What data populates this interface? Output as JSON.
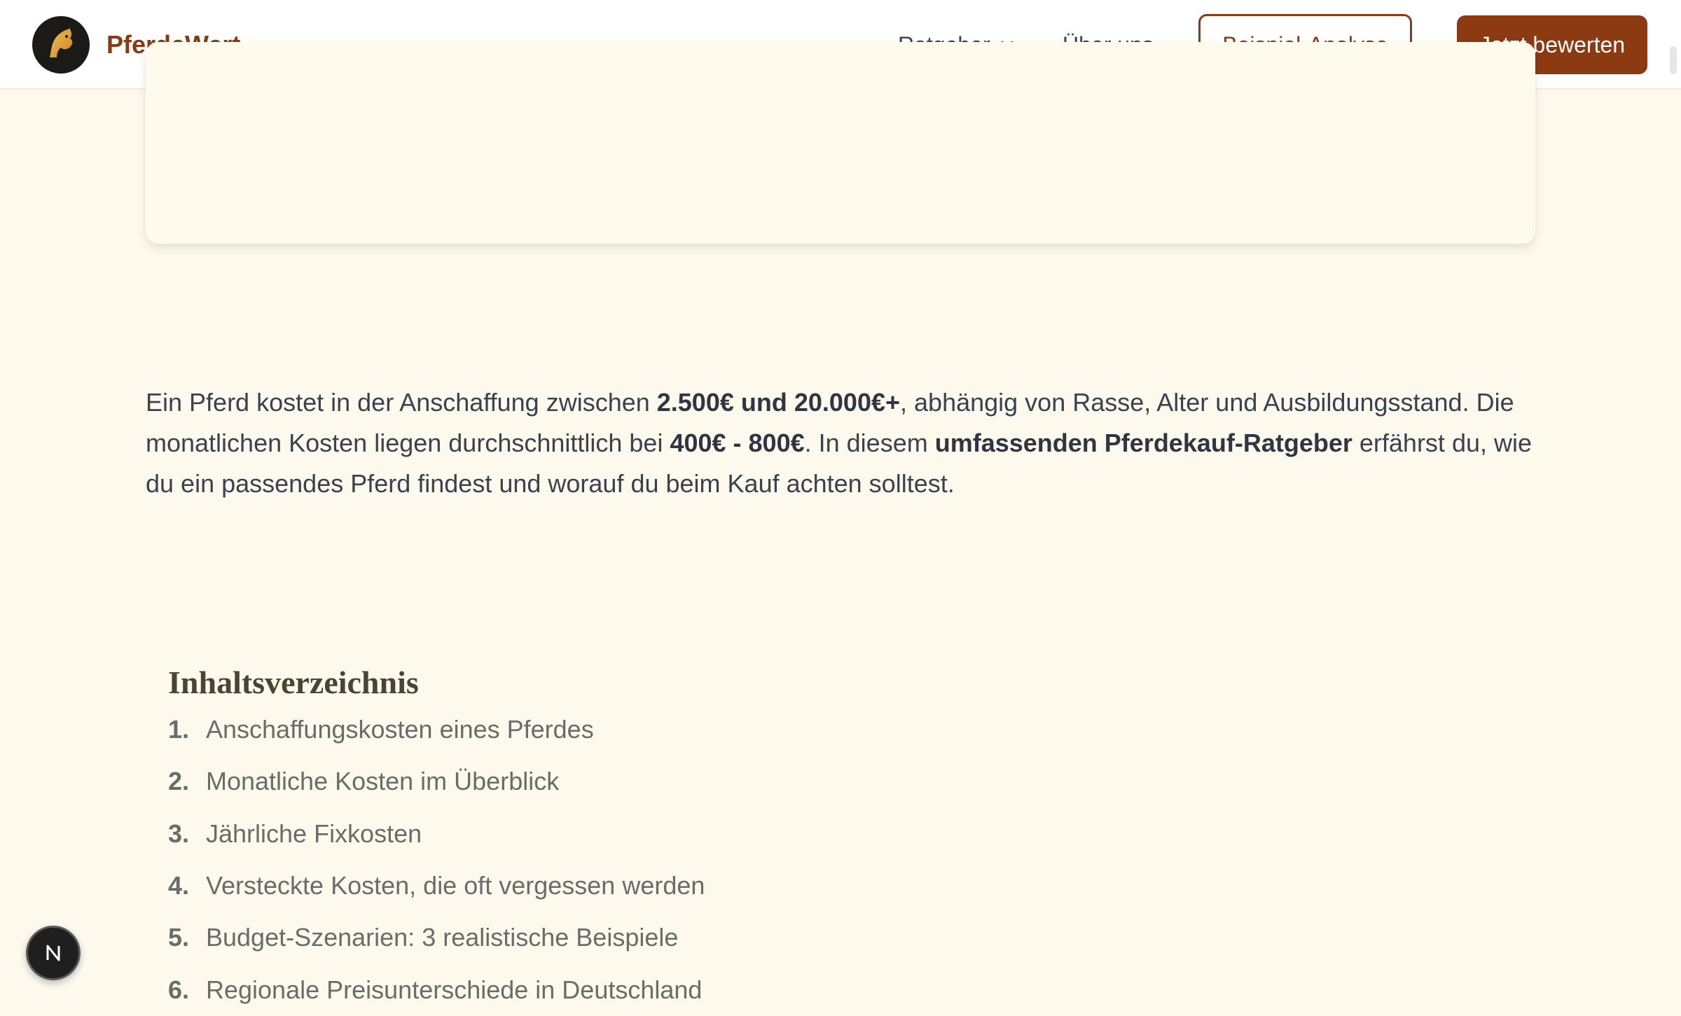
{
  "header": {
    "brand": "PferdeWert",
    "nav": {
      "ratgeber": "Ratgeber",
      "about": "Über uns"
    },
    "buttons": {
      "example": "Beispiel-Analyse",
      "cta": "Jetzt bewerten"
    }
  },
  "intro": {
    "p1": "Ein Pferd kostet in der Anschaffung zwischen ",
    "b1": "2.500€ und 20.000€+",
    "p2": ", abhängig von Rasse, Alter und Ausbildungsstand. Die monatlichen Kosten liegen durchschnittlich bei ",
    "b2": "400€ - 800€",
    "p3": ". In diesem ",
    "b3": "umfassenden Pferdekauf-Ratgeber",
    "p4": " erfährst du, wie du ein passendes Pferd findest und worauf du beim Kauf achten solltest."
  },
  "toc": {
    "title": "Inhaltsverzeichnis",
    "items": [
      {
        "num": "1.",
        "label": "Anschaffungskosten eines Pferdes"
      },
      {
        "num": "2.",
        "label": "Monatliche Kosten im Überblick"
      },
      {
        "num": "3.",
        "label": "Jährliche Fixkosten"
      },
      {
        "num": "4.",
        "label": "Versteckte Kosten, die oft vergessen werden"
      },
      {
        "num": "5.",
        "label": "Budget-Szenarien: 3 realistische Beispiele"
      },
      {
        "num": "6.",
        "label": "Regionale Preisunterschiede in Deutschland"
      }
    ]
  },
  "badge": {
    "letter": "N"
  },
  "colors": {
    "brand": "#8b3a12",
    "background": "#fdf9ec",
    "text": "#3a4150"
  },
  "icons": {
    "logo": "horse-head-icon",
    "chevron": "chevron-down-icon"
  }
}
